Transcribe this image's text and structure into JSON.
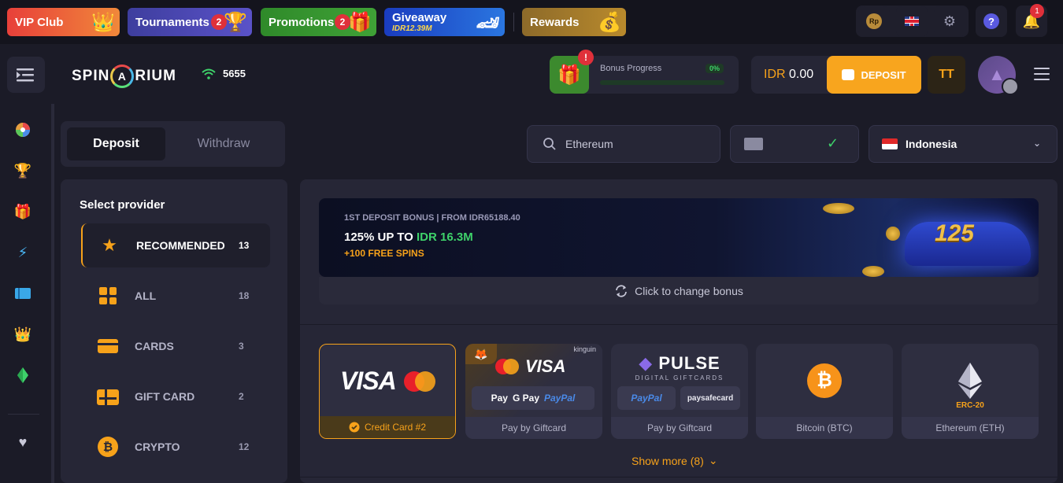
{
  "topbar": {
    "promos": [
      {
        "label": "VIP Club"
      },
      {
        "label": "Tournaments",
        "badge": "2"
      },
      {
        "label": "Promotions",
        "badge": "2"
      },
      {
        "label": "Giveaway",
        "sub": "IDR12.39M"
      },
      {
        "label": "Rewards"
      }
    ],
    "currency_icon": "Rp",
    "notification_count": "1"
  },
  "header": {
    "logo_left": "SPIN",
    "logo_ring": "A",
    "logo_right": "RIUM",
    "online_count": "5655",
    "bonus_progress_label": "Bonus Progress",
    "bonus_progress_pct": "0%",
    "bonus_progress_value": 0,
    "balance_currency": "IDR",
    "balance_amount": "0.00",
    "deposit_label": "DEPOSIT",
    "rg_icon": "TT"
  },
  "tabs": {
    "deposit": "Deposit",
    "withdraw": "Withdraw",
    "active": "deposit"
  },
  "providers": {
    "title": "Select provider",
    "items": [
      {
        "label": "RECOMMENDED",
        "count": "13",
        "icon": "star-icon",
        "active": true
      },
      {
        "label": "ALL",
        "count": "18",
        "icon": "grid-icon"
      },
      {
        "label": "CARDS",
        "count": "3",
        "icon": "card-icon"
      },
      {
        "label": "GIFT CARD",
        "count": "2",
        "icon": "gift-card-icon"
      },
      {
        "label": "CRYPTO",
        "count": "12",
        "icon": "bitcoin-icon"
      }
    ]
  },
  "search": {
    "value": "Ethereum"
  },
  "country": {
    "name": "Indonesia"
  },
  "banner": {
    "subtitle": "1ST DEPOSIT BONUS | FROM IDR65188.40",
    "main_prefix": "125% UP TO ",
    "main_highlight": "IDR 16.3M",
    "spins": "+100 FREE SPINS",
    "art_text": "125",
    "change_label": "Click to change bonus"
  },
  "methods": [
    {
      "name": "Credit Card #2",
      "logo": "VISA",
      "selected": true
    },
    {
      "name": "Pay by Giftcard",
      "logo": "VISA",
      "top_badge": "kinguin",
      "chips": [
        "Pay",
        "G Pay",
        "PayPal"
      ]
    },
    {
      "name": "Pay by Giftcard",
      "logo": "PULSE",
      "logo_sub": "DIGITAL GIFTCARDS",
      "chips": [
        "PayPal",
        "paysafecard"
      ]
    },
    {
      "name": "Bitcoin (BTC)",
      "logo": "₿"
    },
    {
      "name": "Ethereum (ETH)",
      "logo_sub": "ERC-20"
    }
  ],
  "show_more": "Show more (8)"
}
